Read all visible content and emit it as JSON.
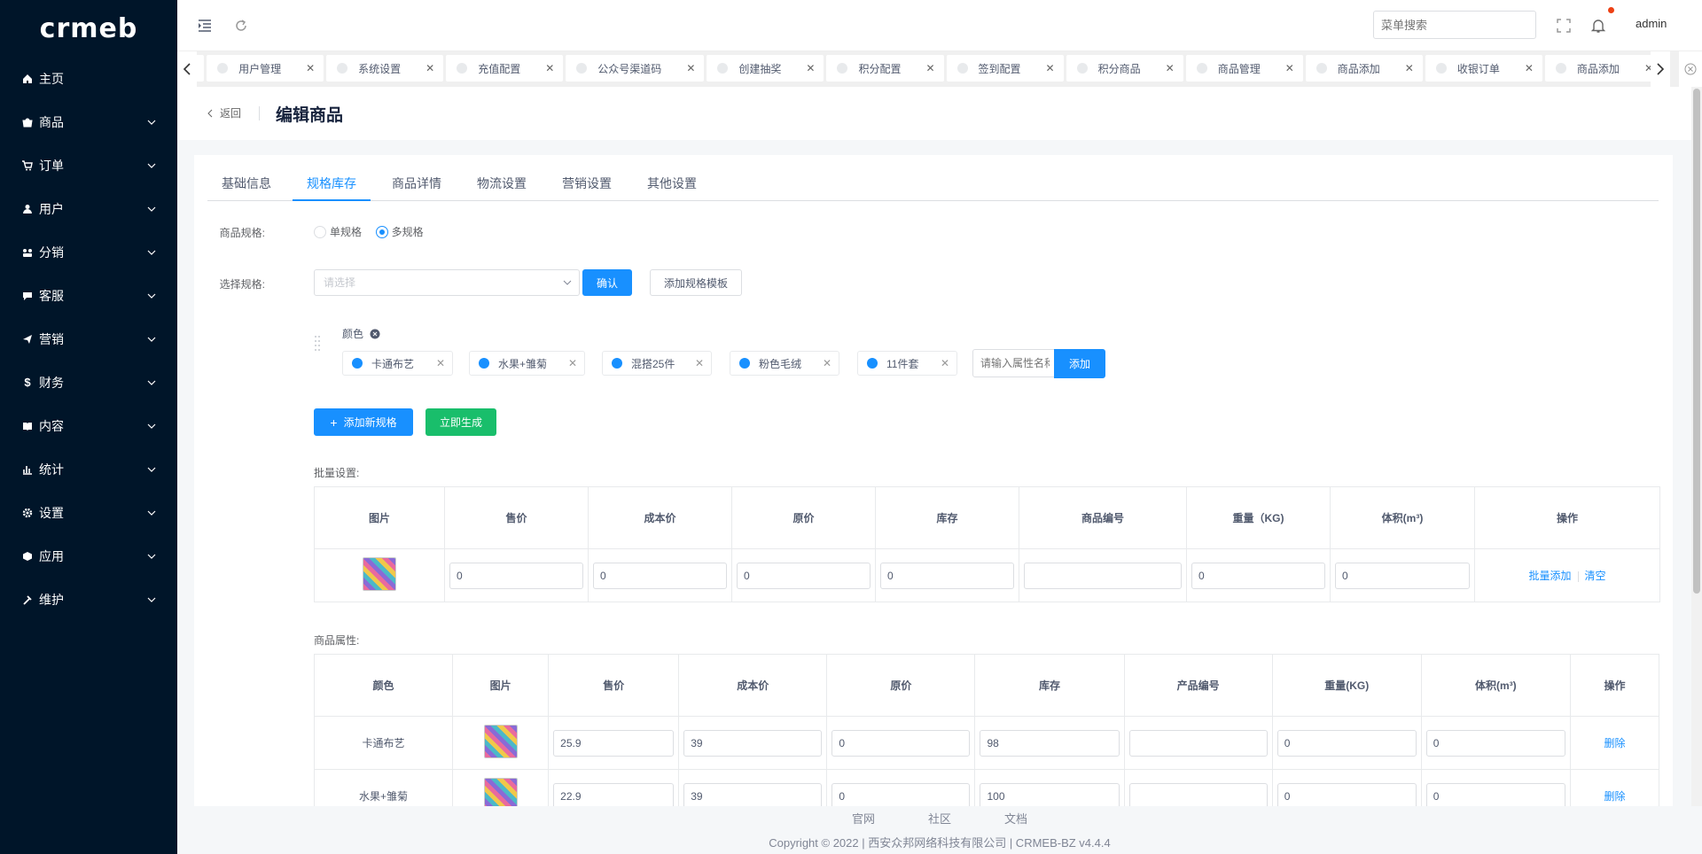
{
  "app": {
    "logo": "crmeb"
  },
  "sidebar": {
    "items": [
      {
        "label": "主页",
        "icon": "home-icon"
      },
      {
        "label": "商品",
        "icon": "shopping-bag-icon"
      },
      {
        "label": "订单",
        "icon": "cart-icon"
      },
      {
        "label": "用户",
        "icon": "user-icon"
      },
      {
        "label": "分销",
        "icon": "distribution-icon"
      },
      {
        "label": "客服",
        "icon": "chat-icon"
      },
      {
        "label": "营销",
        "icon": "send-icon"
      },
      {
        "label": "财务",
        "icon": "dollar-icon"
      },
      {
        "label": "内容",
        "icon": "book-icon"
      },
      {
        "label": "统计",
        "icon": "bar-chart-icon"
      },
      {
        "label": "设置",
        "icon": "gear-icon"
      },
      {
        "label": "应用",
        "icon": "box-icon"
      },
      {
        "label": "维护",
        "icon": "hammer-icon"
      }
    ]
  },
  "header": {
    "search_placeholder": "菜单搜索",
    "user": "admin"
  },
  "tags": [
    {
      "label": ""
    },
    {
      "label": "用户管理"
    },
    {
      "label": "系统设置"
    },
    {
      "label": "充值配置"
    },
    {
      "label": "公众号渠道码"
    },
    {
      "label": "创建抽奖"
    },
    {
      "label": "积分配置"
    },
    {
      "label": "签到配置"
    },
    {
      "label": "积分商品"
    },
    {
      "label": "商品管理"
    },
    {
      "label": "商品添加"
    },
    {
      "label": "收银订单"
    },
    {
      "label": "商品添加"
    }
  ],
  "page": {
    "back": "返回",
    "title": "编辑商品",
    "tabs": [
      "基础信息",
      "规格库存",
      "商品详情",
      "物流设置",
      "营销设置",
      "其他设置"
    ],
    "active_tab": 1
  },
  "form": {
    "spec_label": "商品规格:",
    "spec_single": "单规格",
    "spec_multi": "多规格",
    "choose_label": "选择规格:",
    "choose_placeholder": "请选择",
    "confirm": "确认",
    "add_template": "添加规格模板",
    "attr_name": "颜色",
    "attr_values": [
      "卡通布艺",
      "水果+雏菊",
      "混搭25件",
      "粉色毛绒",
      "11件套"
    ],
    "attr_input_placeholder": "请输入属性名称",
    "attr_add": "添加",
    "add_spec": "添加新规格",
    "generate": "立即生成"
  },
  "batch": {
    "title": "批量设置:",
    "headers": [
      "图片",
      "售价",
      "成本价",
      "原价",
      "库存",
      "商品编号",
      "重量（KG)",
      "体积(m³)",
      "操作"
    ],
    "values": [
      "0",
      "0",
      "0",
      "0",
      "",
      "0",
      "0"
    ],
    "action_add": "批量添加",
    "action_clear": "清空"
  },
  "attrs": {
    "title": "商品属性:",
    "headers": [
      "颜色",
      "图片",
      "售价",
      "成本价",
      "原价",
      "库存",
      "产品编号",
      "重量(KG)",
      "体积(m³)",
      "操作"
    ],
    "rows": [
      {
        "color": "卡通布艺",
        "price": "25.9",
        "cost": "39",
        "orig": "0",
        "stock": "98",
        "code": "",
        "weight": "0",
        "volume": "0",
        "action": "删除"
      },
      {
        "color": "水果+雏菊",
        "price": "22.9",
        "cost": "39",
        "orig": "0",
        "stock": "100",
        "code": "",
        "weight": "0",
        "volume": "0",
        "action": "删除"
      }
    ]
  },
  "footer": {
    "links": [
      "官网",
      "社区",
      "文档"
    ],
    "copyright": "Copyright © 2022 | 西安众邦网络科技有限公司 | CRMEB-BZ v4.4.4"
  },
  "colors": {
    "sidebar_bg": "#001529",
    "primary": "#1890ff",
    "success": "#19be6b"
  }
}
